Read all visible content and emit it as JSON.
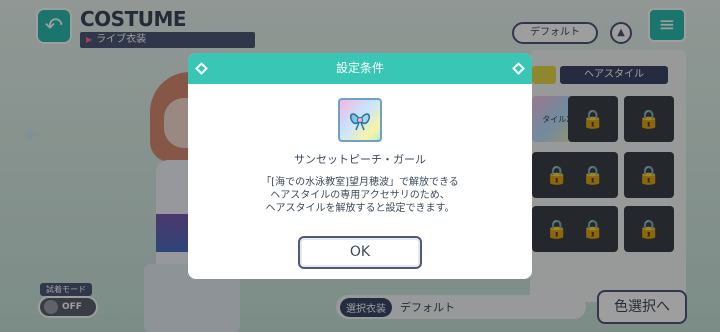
{
  "header": {
    "title": "COSTUME",
    "subtitle": "ライブ衣装",
    "default_button": "デフォルト"
  },
  "panel": {
    "hair_tab": "ヘアスタイル",
    "first_slot_label": "タイルX"
  },
  "trial_mode": {
    "label": "試着モード",
    "toggle": "OFF"
  },
  "selected": {
    "tag": "選択衣装",
    "value": "デフォルト"
  },
  "color_button": "色選択へ",
  "modal": {
    "title": "設定条件",
    "item_name": "サンセットピーチ・ガール",
    "description": [
      "「[海での水泳教室]望月穂波」で解放できる",
      "ヘアスタイルの専用アクセサリのため、",
      "ヘアスタイルを解放すると設定できます。"
    ],
    "ok_label": "OK"
  },
  "icons": {
    "back": "back-arrow-icon",
    "menu": "hamburger-menu-icon",
    "lock": "lock-icon",
    "item": "bow-accessory-icon"
  },
  "colors": {
    "accent": "#39c6b4",
    "navy": "#3d4766"
  }
}
